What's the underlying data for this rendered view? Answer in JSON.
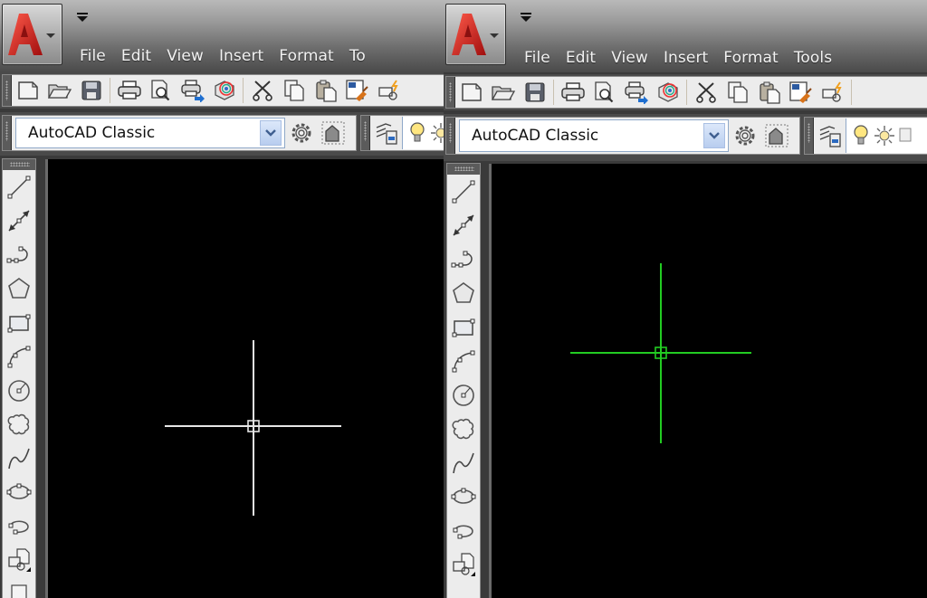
{
  "panels": [
    {
      "id": "left",
      "menu": [
        "File",
        "Edit",
        "View",
        "Insert",
        "Format",
        "To"
      ],
      "workspace": "AutoCAD Classic",
      "crosshair_color": "#e6e6e6",
      "layer_icons": [
        "layer-properties-icon",
        "lightbulb-icon",
        "sun-icon"
      ]
    },
    {
      "id": "right",
      "menu": [
        "File",
        "Edit",
        "View",
        "Insert",
        "Format",
        "Tools"
      ],
      "workspace": "AutoCAD Classic",
      "crosshair_color": "#22cc22",
      "layer_icons": [
        "layer-properties-icon",
        "lightbulb-icon",
        "sun-icon",
        "freeze-icon"
      ]
    }
  ],
  "standard_toolbar": [
    "new",
    "open",
    "save",
    "plot",
    "plot-preview",
    "publish",
    "3d-dwf",
    "cut",
    "copy",
    "paste",
    "match-properties",
    "block-editor"
  ],
  "draw_toolbar": [
    "line",
    "construction-line",
    "polyline",
    "polygon",
    "rectangle",
    "arc",
    "circle",
    "revision-cloud",
    "spline",
    "ellipse",
    "ellipse-arc",
    "insert-block",
    "make-block"
  ],
  "colors": {
    "canvas": "#000000",
    "toolbar_bg": "#ececec",
    "accent_red": "#d42020",
    "combo_border": "#8fa8c8"
  }
}
